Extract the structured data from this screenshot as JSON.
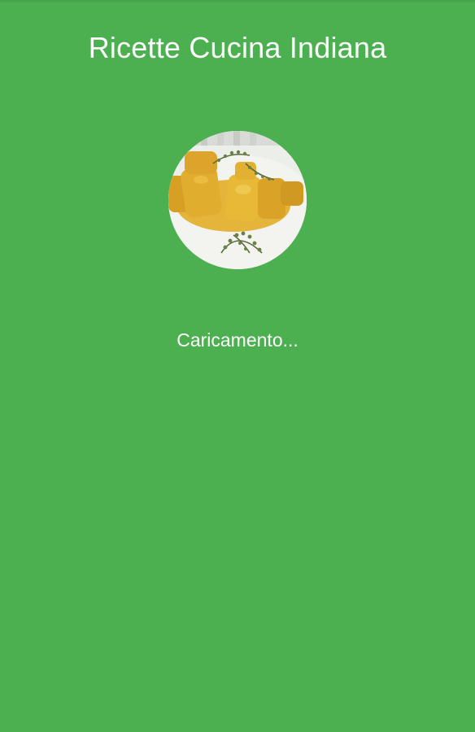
{
  "splash": {
    "app_title": "Ricette Cucina Indiana",
    "loading_text": "Caricamento...",
    "logo_icon": "chicken-curry-dish-icon"
  },
  "colors": {
    "background": "#4caf50",
    "text": "#ffffff"
  }
}
